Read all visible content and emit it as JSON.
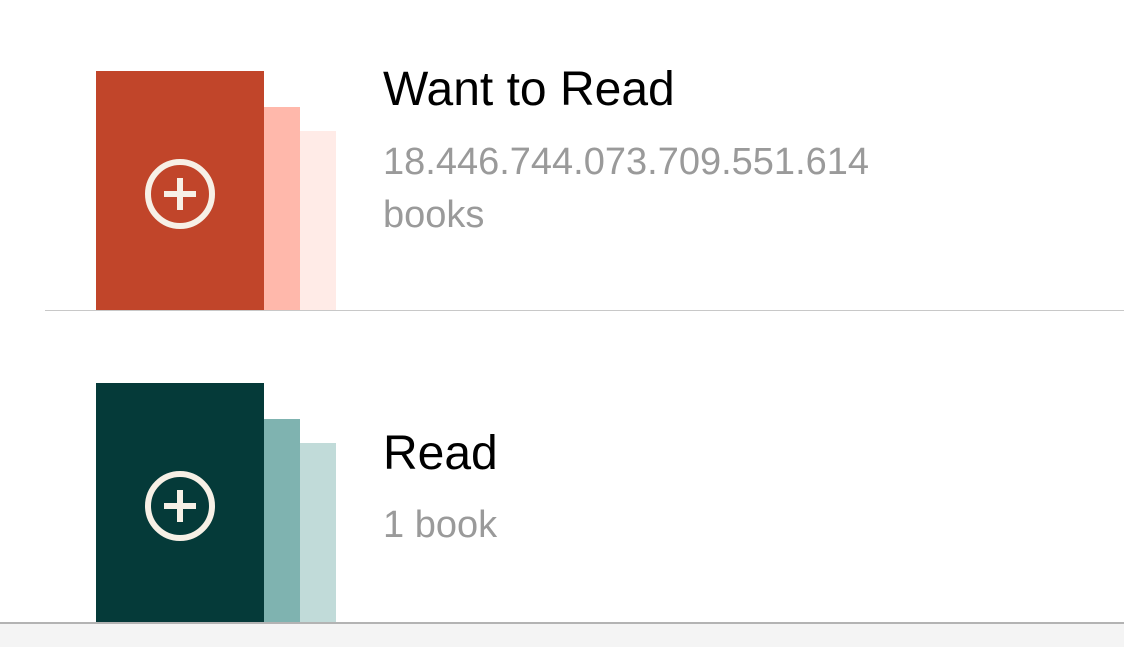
{
  "shelves": [
    {
      "title": "Want to Read",
      "count": "18.446.744.073.709.551.614 books",
      "colors": {
        "front": "#c1452a",
        "middle": "#ffb8ab",
        "back": "#ffebe7",
        "icon": "#f7f0e6"
      },
      "icon": "add-circle-icon"
    },
    {
      "title": "Read",
      "count": "1 book",
      "colors": {
        "front": "#053a39",
        "middle": "#7fb3b0",
        "back": "#c1dbd9",
        "icon": "#f7f0e6"
      },
      "icon": "add-circle-icon"
    }
  ]
}
